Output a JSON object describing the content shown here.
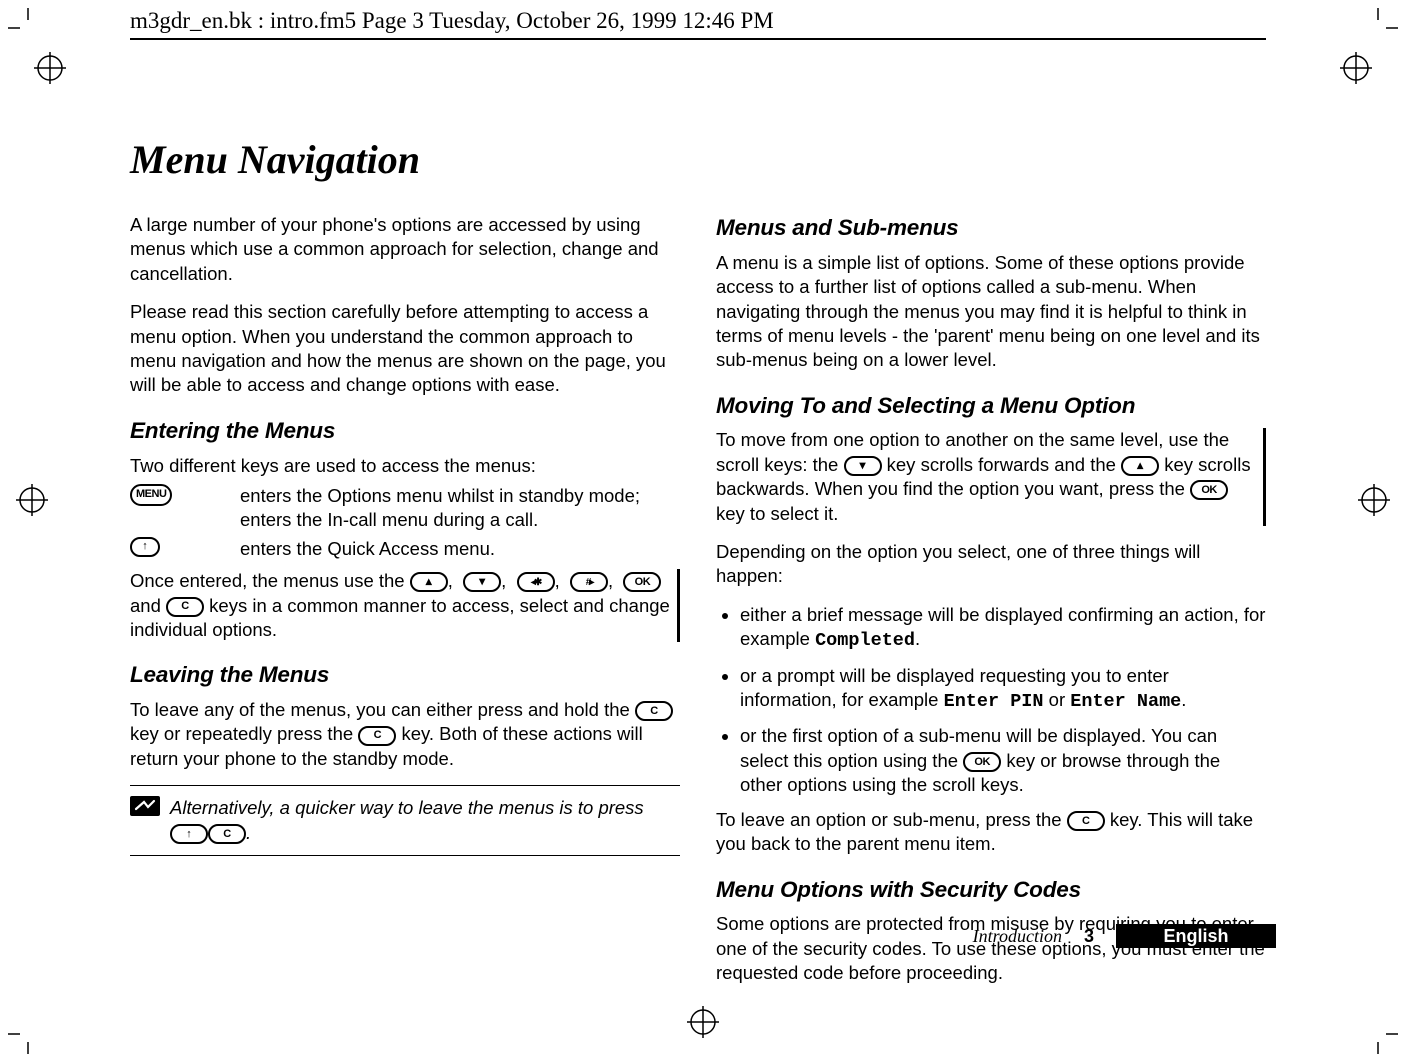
{
  "running_header": "m3gdr_en.bk : intro.fm5  Page 3  Tuesday, October 26, 1999  12:46 PM",
  "title": "Menu Navigation",
  "footer": {
    "section": "Introduction",
    "page": "3",
    "language": "English"
  },
  "left": {
    "intro1": "A large number of your phone's options are accessed by using menus which use a common approach for selection, change and cancellation.",
    "intro2": "Please read this section carefully before attempting to access a menu option. When you understand the common approach to menu navigation and how the menus are shown on the page, you will be able to access and change options with ease.",
    "entering_heading": "Entering the Menus",
    "entering_intro": "Two different keys are used to access the menus:",
    "menu_key_desc": "enters the Options menu whilst in standby mode; enters the In-call menu during a call.",
    "qa_key_desc": "enters the Quick Access menu.",
    "once_entered_pre": "Once entered, the menus use the ",
    "once_entered_mid": " and ",
    "once_entered_post": " keys in a common manner to access, select and change individual options.",
    "leaving_heading": "Leaving the Menus",
    "leaving_pre": "To leave any of the menus, you can either press and hold the ",
    "leaving_mid": " key or repeatedly press the ",
    "leaving_post": " key. Both of these actions will return your phone to the standby mode.",
    "note_text_pre": "Alternatively, a quicker way to leave the menus is to press ",
    "note_text_post": "."
  },
  "right": {
    "submenus_heading": "Menus and Sub-menus",
    "submenus_para": "A menu is a simple list of options. Some of these options provide access to a further list of options called a sub-menu. When navigating through the menus you may find it is helpful to think in terms of menu levels - the 'parent' menu being on one level and its sub-menus being on a lower level.",
    "moving_heading": "Moving To and Selecting a Menu Option",
    "moving_para_pre": "To move from one option to another on the same level, use the scroll keys: the ",
    "moving_para_mid1": " key scrolls forwards and the ",
    "moving_para_mid2": " key scrolls backwards. When you find the option you want, press the ",
    "moving_para_post": " key to select it.",
    "depending": "Depending on the option you select, one of three things will happen:",
    "bullet1_pre": "either a brief message will be displayed confirming an action, for example ",
    "bullet1_code": "Completed",
    "bullet1_post": ".",
    "bullet2_pre": "or a prompt will be displayed requesting you to enter information, for example ",
    "bullet2_code1": "Enter PIN",
    "bullet2_or": " or ",
    "bullet2_code2": "Enter Name",
    "bullet2_post": ".",
    "bullet3_pre": "or the first option of a sub-menu will be displayed. You can select this option using the ",
    "bullet3_post": " key or browse through the other options using the scroll keys.",
    "leave_pre": "To leave an option or sub-menu, press the ",
    "leave_post": " key. This will take you back to the parent menu item.",
    "security_heading": "Menu Options with Security Codes",
    "security_para": "Some options are protected from misuse by requiring you to enter one of the security codes. To use these options, you must enter the requested code before proceeding."
  },
  "key_labels": {
    "menu": "MENU",
    "ok": "OK",
    "c": "C"
  }
}
